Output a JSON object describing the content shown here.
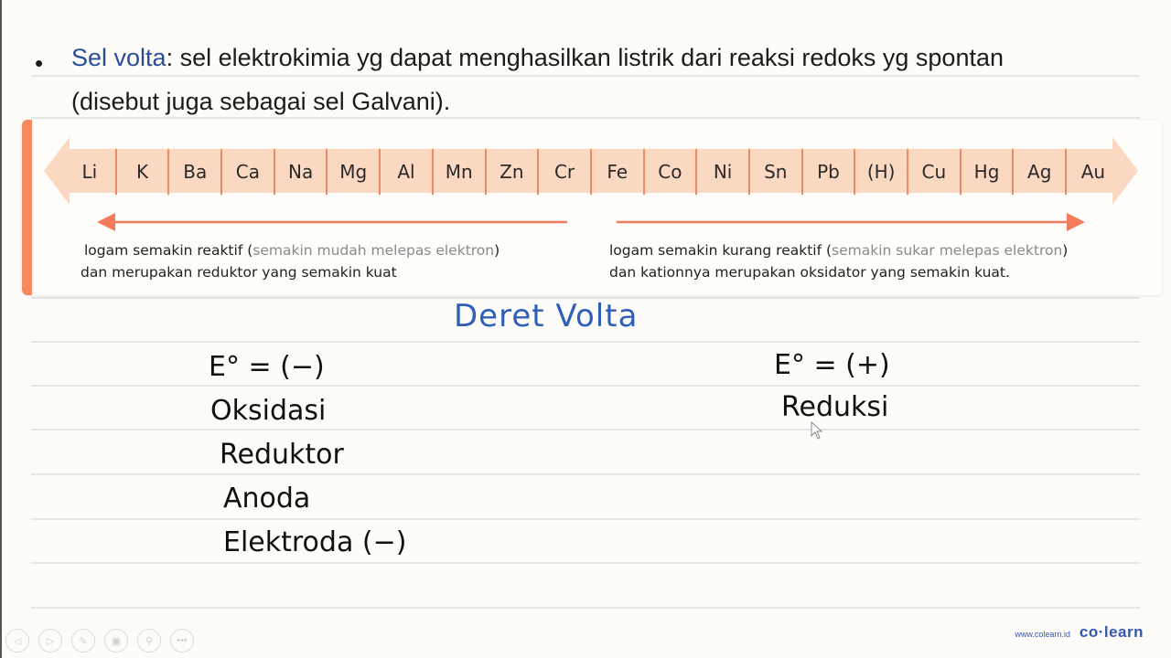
{
  "bullet": {
    "term": "Sel volta",
    "line1_rest": ": sel elektrokimia yg dapat menghasilkan listrik dari reaksi redoks yg spontan",
    "line2": "(disebut juga sebagai sel Galvani)."
  },
  "volta_series": {
    "metals": [
      "Li",
      "K",
      "Ba",
      "Ca",
      "Na",
      "Mg",
      "Al",
      "Mn",
      "Zn",
      "Cr",
      "Fe",
      "Co",
      "Ni",
      "Sn",
      "Pb",
      "(H)",
      "Cu",
      "Hg",
      "Ag",
      "Au"
    ],
    "band_color": "#fbd8c2",
    "divider_color": "#e98a66",
    "arrow_color": "#f47c5c"
  },
  "left_desc": {
    "line1_a": "logam semakin reaktif (",
    "line1_b": "semakin mudah melepas elektron",
    "line1_c": ")",
    "line2": "dan merupakan reduktor yang semakin kuat"
  },
  "right_desc": {
    "line1_a": "logam semakin kurang reaktif (",
    "line1_b": "semakin sukar melepas elektron",
    "line1_c": ")",
    "line2": "dan kationnya merupakan oksidator yang semakin kuat."
  },
  "handwriting": {
    "title": "Deret Volta",
    "left": [
      "E° = (−)",
      "Oksidasi",
      "Reduktor",
      "Anoda",
      "Elektroda (−)"
    ],
    "right": [
      "E° = (+)",
      "Reduksi"
    ]
  },
  "toolbar": {
    "buttons": [
      {
        "name": "prev-icon",
        "glyph": "◁"
      },
      {
        "name": "next-icon",
        "glyph": "▷"
      },
      {
        "name": "pen-icon",
        "glyph": "✎"
      },
      {
        "name": "slides-icon",
        "glyph": "▣"
      },
      {
        "name": "zoom-icon",
        "glyph": "⚲"
      },
      {
        "name": "more-icon",
        "glyph": "•••"
      }
    ]
  },
  "brand": {
    "url": "www.colearn.id",
    "logo": "co·learn"
  }
}
